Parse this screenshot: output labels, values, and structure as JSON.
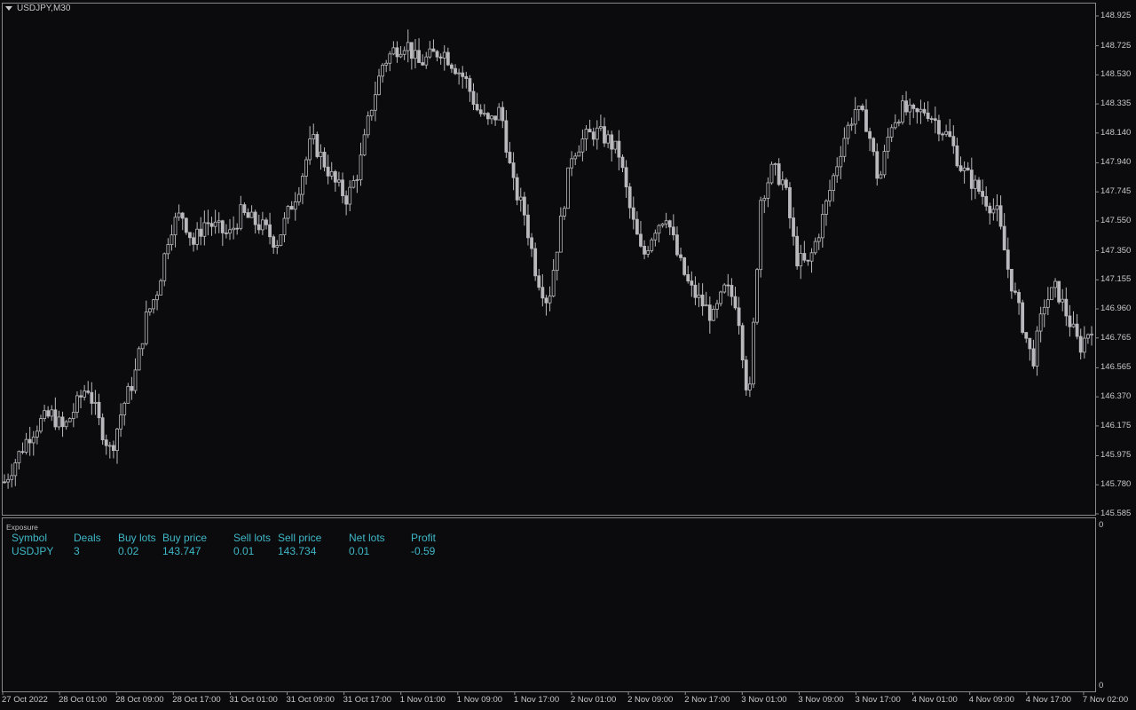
{
  "window": {
    "title": "USDJPY,M30"
  },
  "colors": {
    "background": "#0b0b0e",
    "candle": "#b9b9bd",
    "grid_line": "#8a8a8a",
    "text": "#c8c8c8",
    "table_text": "#3fb7c6"
  },
  "chart_data": {
    "type": "candlestick",
    "symbol": "USDJPY",
    "timeframe": "M30",
    "ylim": [
      145.585,
      148.925
    ],
    "price_ticks": [
      "148.925",
      "148.725",
      "148.530",
      "148.335",
      "148.140",
      "147.940",
      "147.745",
      "147.550",
      "147.350",
      "147.155",
      "146.960",
      "146.765",
      "146.565",
      "146.370",
      "146.175",
      "145.975",
      "145.780",
      "145.585"
    ],
    "time_ticks": [
      "27 Oct 2022",
      "28 Oct 01:00",
      "28 Oct 09:00",
      "28 Oct 17:00",
      "31 Oct 01:00",
      "31 Oct 09:00",
      "31 Oct 17:00",
      "1 Nov 01:00",
      "1 Nov 09:00",
      "1 Nov 17:00",
      "2 Nov 01:00",
      "2 Nov 09:00",
      "2 Nov 17:00",
      "3 Nov 01:00",
      "3 Nov 09:00",
      "3 Nov 17:00",
      "4 Nov 01:00",
      "4 Nov 09:00",
      "4 Nov 17:00",
      "7 Nov 02:00"
    ],
    "close_path": [
      145.8,
      145.95,
      146.1,
      146.2,
      146.25,
      146.15,
      146.3,
      146.45,
      146.2,
      146.0,
      146.3,
      146.5,
      146.9,
      147.1,
      147.5,
      147.6,
      147.4,
      147.55,
      147.5,
      147.45,
      147.6,
      147.55,
      147.5,
      147.4,
      147.6,
      147.8,
      148.1,
      147.95,
      147.8,
      147.7,
      147.9,
      148.3,
      148.6,
      148.7,
      148.75,
      148.6,
      148.65,
      148.7,
      148.6,
      148.5,
      148.3,
      148.2,
      148.3,
      147.8,
      147.6,
      147.2,
      147.0,
      147.5,
      148.0,
      148.1,
      148.15,
      148.1,
      148.0,
      147.6,
      147.3,
      147.5,
      147.6,
      147.3,
      147.1,
      147.0,
      146.9,
      147.1,
      147.0,
      146.3,
      147.7,
      147.9,
      147.8,
      147.3,
      147.25,
      147.5,
      147.8,
      148.1,
      148.3,
      148.2,
      147.8,
      148.2,
      148.3,
      148.25,
      148.3,
      148.2,
      148.1,
      147.9,
      147.8,
      147.7,
      147.6,
      147.2,
      146.9,
      146.6,
      147.0,
      147.1,
      146.9,
      146.7,
      146.85
    ],
    "sub_window_ylim": [
      0,
      0
    ]
  },
  "subwindow": {
    "title": "Exposure",
    "scale_top": "0",
    "scale_bottom": "0",
    "headers": [
      "Symbol",
      "Deals",
      "Buy lots",
      "Buy price",
      "Sell lots",
      "Sell price",
      "Net lots",
      "Profit"
    ],
    "row": [
      "USDJPY",
      "3",
      "0.02",
      "143.747",
      "0.01",
      "143.734",
      "0.01",
      "-0.59"
    ]
  }
}
